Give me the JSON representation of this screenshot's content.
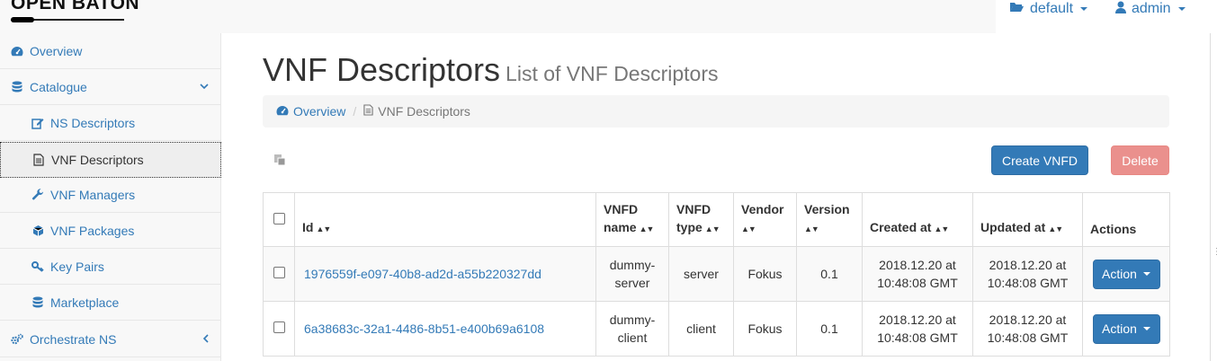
{
  "brand": {
    "name": "OPEN BATON"
  },
  "topnav": {
    "project": "default",
    "user": "admin"
  },
  "sidebar": {
    "items": [
      {
        "label": "Overview",
        "icon": "dashboard-icon"
      },
      {
        "label": "Catalogue",
        "icon": "database-icon",
        "expanded": true
      },
      {
        "label": "NS Descriptors",
        "icon": "edit-icon"
      },
      {
        "label": "VNF Descriptors",
        "icon": "file-icon",
        "active": true
      },
      {
        "label": "VNF Managers",
        "icon": "wrench-icon"
      },
      {
        "label": "VNF Packages",
        "icon": "cube-icon"
      },
      {
        "label": "Key Pairs",
        "icon": "key-icon"
      },
      {
        "label": "Marketplace",
        "icon": "database-icon"
      },
      {
        "label": "Orchestrate NS",
        "icon": "cogs-icon",
        "expanded": false
      }
    ]
  },
  "page": {
    "title": "VNF Descriptors",
    "subtitle": "List of VNF Descriptors"
  },
  "breadcrumb": {
    "home": "Overview",
    "current": "VNF Descriptors"
  },
  "toolbar": {
    "create_label": "Create VNFD",
    "delete_label": "Delete"
  },
  "table": {
    "headers": {
      "id": "Id",
      "name_1": "VNFD",
      "name_2": "name",
      "type_1": "VNFD",
      "type_2": "type",
      "vendor": "Vendor",
      "version": "Version",
      "created": "Created at",
      "updated": "Updated at",
      "actions": "Actions"
    },
    "rows": [
      {
        "id": "1976559f-e097-40b8-ad2d-a55b220327dd",
        "name_1": "dummy-",
        "name_2": "server",
        "type": "server",
        "vendor": "Fokus",
        "version": "0.1",
        "created_1": "2018.12.20 at",
        "created_2": "10:48:08 GMT",
        "updated_1": "2018.12.20 at",
        "updated_2": "10:48:08 GMT",
        "action": "Action"
      },
      {
        "id": "6a38683c-32a1-4486-8b51-e400b69a6108",
        "name_1": "dummy-",
        "name_2": "client",
        "type": "client",
        "vendor": "Fokus",
        "version": "0.1",
        "created_1": "2018.12.20 at",
        "created_2": "10:48:08 GMT",
        "updated_1": "2018.12.20 at",
        "updated_2": "10:48:08 GMT",
        "action": "Action"
      }
    ]
  },
  "colors": {
    "primary": "#337ab7",
    "danger_disabled": "#e98b87",
    "sidebar_bg": "#f8f8f8"
  }
}
